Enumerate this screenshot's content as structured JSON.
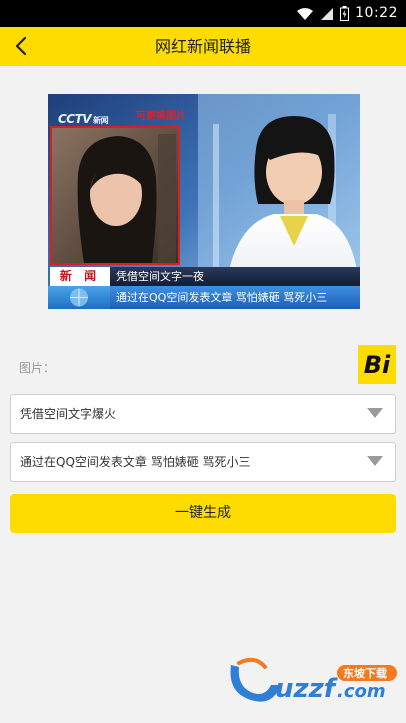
{
  "status_bar": {
    "time": "10:22",
    "icons": [
      "wifi-icon",
      "signal-icon",
      "battery-icon"
    ]
  },
  "app_bar": {
    "back_icon": "chevron-left-icon",
    "title": "网红新闻联播"
  },
  "preview": {
    "logo": "CCTV",
    "logo_sub": "新闻",
    "replace_hint": "可更换图片",
    "news_tag": "新 闻",
    "headline_line1": "凭借空间文字一夜",
    "headline_line2": "通过在QQ空间发表文章 骂怕婊砸 骂死小三"
  },
  "form": {
    "image_label": "图片：",
    "badge_text": "Bi",
    "select1_value": "凭借空间文字爆火",
    "select2_value": "通过在QQ空间发表文章 骂怕婊砸 骂死小三",
    "generate_label": "一键生成"
  },
  "watermark": {
    "brand": "uzzf",
    "domain": ".com",
    "tagline": "东坡下载"
  },
  "colors": {
    "accent": "#ffdc00",
    "background": "#f2f2f2",
    "hint_red": "#e0202a"
  }
}
